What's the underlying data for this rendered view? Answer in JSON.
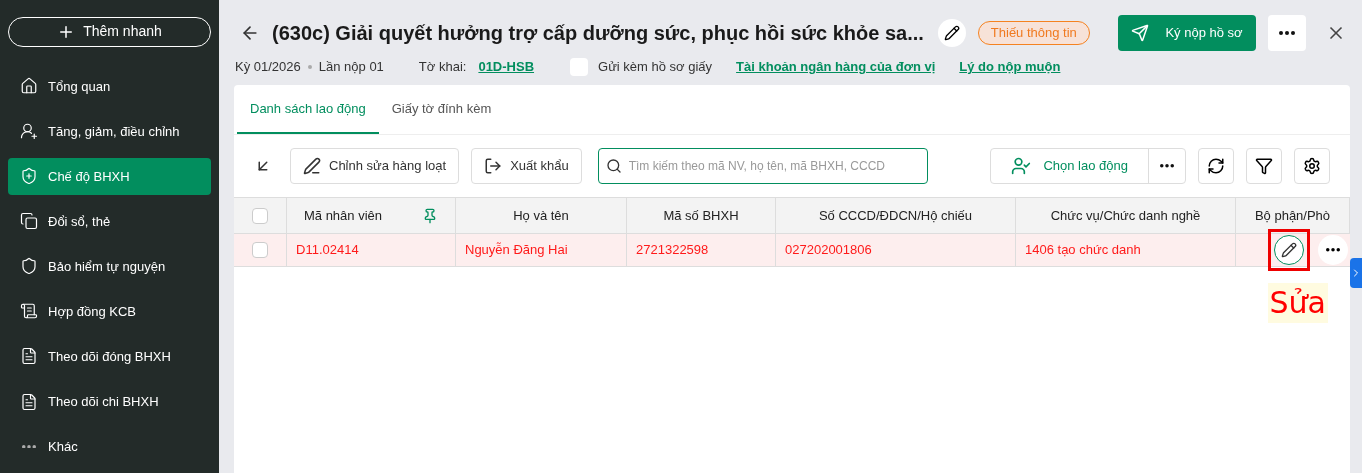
{
  "sidebar": {
    "quick_add": "Thêm nhanh",
    "items": [
      {
        "label": "Tổng quan",
        "selected": false
      },
      {
        "label": "Tăng, giảm, điều chỉnh",
        "selected": false
      },
      {
        "label": "Chế độ BHXH",
        "selected": true
      },
      {
        "label": "Đổi sổ, thẻ",
        "selected": false
      },
      {
        "label": "Bảo hiểm tự nguyện",
        "selected": false
      },
      {
        "label": "Hợp đồng KCB",
        "selected": false
      },
      {
        "label": "Theo dõi đóng BHXH",
        "selected": false
      },
      {
        "label": "Theo dõi chi BHXH",
        "selected": false
      },
      {
        "label": "Khác",
        "selected": false
      }
    ]
  },
  "header": {
    "title": "(630c) Giải quyết hưởng trợ cấp dưỡng sức, phục hồi sức khỏe sa...",
    "status": "Thiếu thông tin",
    "submit": "Ký nộp hồ sơ",
    "period": "Kỳ 01/2026",
    "attempt": "Lần nộp 01",
    "form_label": "Tờ khai:",
    "form_link": "01D-HSB",
    "paper": {
      "label": "Gửi kèm hồ sơ giấy",
      "checked": false
    },
    "links": [
      "Tài khoản ngân hàng của đơn vị",
      "Lý do nộp muộn"
    ]
  },
  "tabs": [
    {
      "label": "Danh sách lao động",
      "selected": true
    },
    {
      "label": "Giấy tờ đính kèm",
      "selected": false
    }
  ],
  "toolbar": {
    "bulk_edit": "Chỉnh sửa hàng loạt",
    "export": "Xuất khẩu",
    "search": {
      "placeholder": "Tìm kiếm theo mã NV, họ tên, mã BHXH, CCCD"
    },
    "choose": "Chọn lao động"
  },
  "table": {
    "select_all_checked": false,
    "columns": [
      "Mã nhân viên",
      "Họ và tên",
      "Mã số BHXH",
      "Số CCCD/ĐDCN/Hộ chiếu",
      "Chức vụ/Chức danh nghề",
      "Bộ phận/Phò"
    ],
    "rows": [
      {
        "checked": false,
        "error": true,
        "cells": [
          "D11.02414",
          "Nguyễn Đăng Hai",
          "2721322598",
          "027202001806",
          "1406 tạo chức danh"
        ]
      }
    ]
  },
  "annotation": {
    "label": "Sửa"
  }
}
